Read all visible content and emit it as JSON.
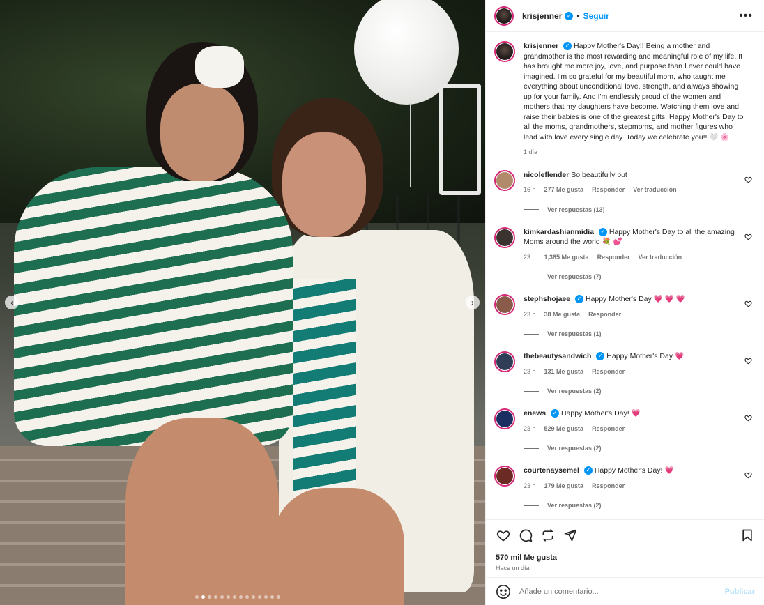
{
  "post": {
    "author": "krisjenner",
    "follow_label": "Seguir",
    "separator": "•",
    "more_icon": "more-horizontal-icon",
    "caption": "Happy Mother's Day!! Being a mother and grandmother is the most rewarding and meaningful role of my life. It has brought me more joy, love, and purpose than I ever could have imagined. I'm so grateful for my beautiful mom, who taught me everything about unconditional love, strength, and always showing up for your family. And I'm endlessly proud of the women and mothers that my daughters have become. Watching them love and raise their babies is one of the greatest gifts. Happy Mother's Day to all the moms, grandmothers, stepmoms, and mother figures who lead with love every single day. Today we celebrate you!! 🤍 🌸",
    "caption_time": "1 día",
    "carousel": {
      "dot_count": 14,
      "active_index": 1
    }
  },
  "comments": [
    {
      "user": "nicoleflender",
      "verified": false,
      "text": "So beautifully put",
      "time": "16 h",
      "likes": "277 Me gusta",
      "reply": "Responder",
      "translate": "Ver traducción",
      "replies": "Ver respuestas (13)",
      "avatar_color": "#b08a6a"
    },
    {
      "user": "kimkardashianmidia",
      "verified": true,
      "text": "Happy Mother's Day to all the amazing Moms around the world 💐 💕",
      "time": "23 h",
      "likes": "1,385 Me gusta",
      "reply": "Responder",
      "translate": "Ver traducción",
      "replies": "Ver respuestas (7)",
      "avatar_color": "#3a3330"
    },
    {
      "user": "stephshojaee",
      "verified": true,
      "text": "Happy Mother's Day 💗 💗 💗",
      "time": "23 h",
      "likes": "38 Me gusta",
      "reply": "Responder",
      "translate": "",
      "replies": "Ver respuestas (1)",
      "avatar_color": "#8a5a4a"
    },
    {
      "user": "thebeautysandwich",
      "verified": true,
      "text": "Happy Mother's Day 💗",
      "time": "23 h",
      "likes": "131 Me gusta",
      "reply": "Responder",
      "translate": "",
      "replies": "Ver respuestas (2)",
      "avatar_color": "#2f3d57"
    },
    {
      "user": "enews",
      "verified": true,
      "text": "Happy Mother's Day! 💗",
      "time": "23 h",
      "likes": "529 Me gusta",
      "reply": "Responder",
      "translate": "",
      "replies": "Ver respuestas (2)",
      "avatar_color": "#1b2f63"
    },
    {
      "user": "courtenaysemel",
      "verified": true,
      "text": "Happy Mother's Day! 💗",
      "time": "23 h",
      "likes": "179 Me gusta",
      "reply": "Responder",
      "translate": "",
      "replies": "Ver respuestas (2)",
      "avatar_color": "#6b2a24"
    }
  ],
  "actions": {
    "like_icon": "heart-icon",
    "comment_icon": "comment-icon",
    "share_icon": "repost-icon",
    "send_icon": "send-icon",
    "save_icon": "bookmark-icon",
    "likes_count": "570 mil Me gusta",
    "posted": "Hace un día"
  },
  "composer": {
    "placeholder": "Añade un comentario...",
    "publish_label": "Publicar"
  }
}
